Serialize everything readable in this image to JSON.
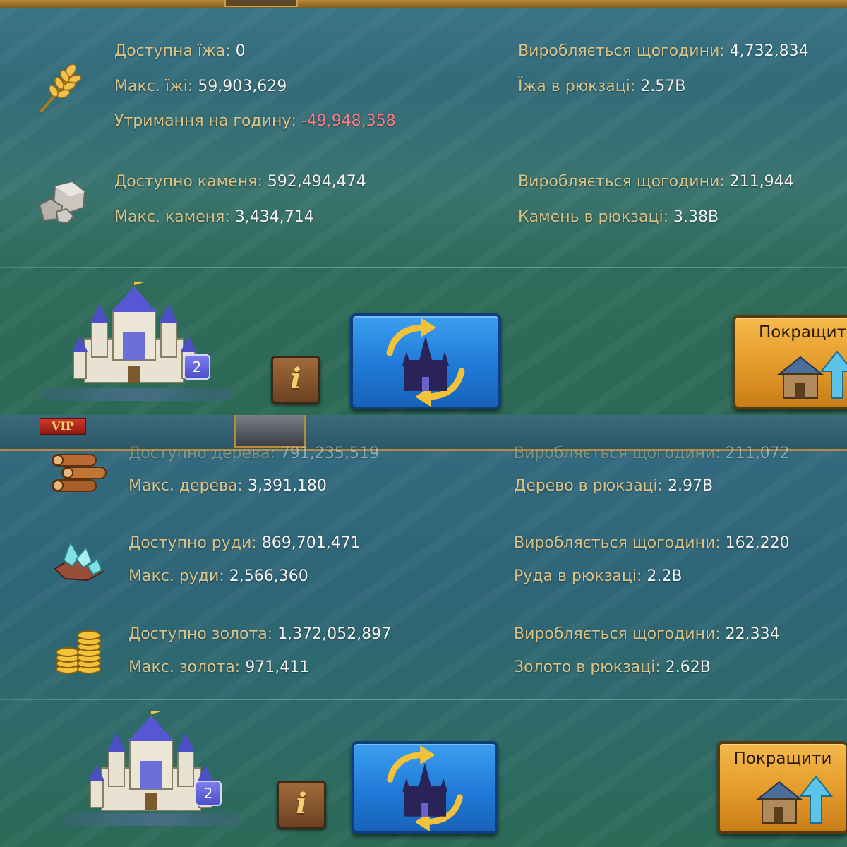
{
  "top_panel": {
    "food": {
      "available": "Доступна їжа:",
      "available_val": "0",
      "max": "Макс. їжі:",
      "max_val": "59,903,629",
      "upkeep": "Утримання на годину:",
      "upkeep_val": "-49,948,358",
      "produced": "Виробляється щогодини:",
      "produced_val": "4,732,834",
      "backpack": "Їжа в рюкзаці:",
      "backpack_val": "2.57B"
    },
    "stone": {
      "available": "Доступно каменя:",
      "available_val": "592,494,474",
      "max": "Макс. каменя:",
      "max_val": "3,434,714",
      "produced": "Виробляється щогодини:",
      "produced_val": "211,944",
      "backpack": "Камень в рюкзаці:",
      "backpack_val": "3.38B"
    },
    "castle_level": "2",
    "info_label": "i",
    "upgrade_label": "Покращит"
  },
  "bottom_panel": {
    "vip_label": "VIP",
    "wood": {
      "available": "Доступно дерева:",
      "available_val": "791,235,519",
      "max": "Макс. дерева:",
      "max_val": "3,391,180",
      "produced": "Виробляється щогодини:",
      "produced_val": "211,072",
      "backpack": "Дерево в рюкзаці:",
      "backpack_val": "2.97B"
    },
    "ore": {
      "available": "Доступно руди:",
      "available_val": "869,701,471",
      "max": "Макс. руди:",
      "max_val": "2,566,360",
      "produced": "Виробляється щогодини:",
      "produced_val": "162,220",
      "backpack": "Руда в рюкзаці:",
      "backpack_val": "2.2B"
    },
    "gold": {
      "available": "Доступно золота:",
      "available_val": "1,372,052,897",
      "max": "Макс. золота:",
      "max_val": "971,411",
      "produced": "Виробляється щогодини:",
      "produced_val": "22,334",
      "backpack": "Золото в рюкзаці:",
      "backpack_val": "2.62B"
    },
    "castle_level": "2",
    "info_label": "i",
    "upgrade_label": "Покращити"
  },
  "colors": {
    "label": "#d8c48a",
    "value": "#f4f4f0",
    "negative": "#ff7a86",
    "swap_button": "#1f7ad8",
    "upgrade_button": "#e39a2a"
  },
  "icons": [
    "wheat-icon",
    "stone-icon",
    "wood-icon",
    "ore-icon",
    "gold-icon",
    "castle-icon",
    "swap-icon",
    "upgrade-icon"
  ]
}
